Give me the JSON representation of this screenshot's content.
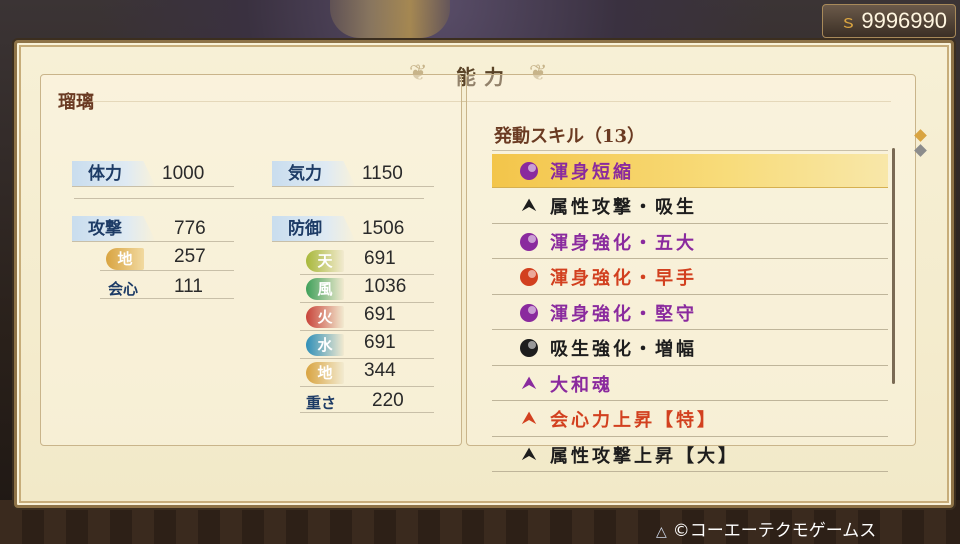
{
  "money": {
    "icon": "coin-icon",
    "value": "9996990"
  },
  "panel": {
    "title": "能力"
  },
  "character": {
    "name": "瑠璃"
  },
  "left_stats": {
    "stamina": {
      "label": "体力",
      "value": "1000"
    },
    "spirit": {
      "label": "気力",
      "value": "1150"
    },
    "attack": {
      "label": "攻撃",
      "value": "776"
    },
    "attack_element": {
      "label": "地",
      "value": "257",
      "color": "#d9a441"
    },
    "critical": {
      "label": "会心",
      "value": "111"
    },
    "defense": {
      "label": "防御",
      "value": "1506"
    },
    "defense_elements": [
      {
        "label": "天",
        "value": "691",
        "color": "#a8b83a"
      },
      {
        "label": "風",
        "value": "1036",
        "color": "#3fa05a"
      },
      {
        "label": "火",
        "value": "691",
        "color": "#c8443a"
      },
      {
        "label": "水",
        "value": "691",
        "color": "#2f8fb8"
      },
      {
        "label": "地",
        "value": "344",
        "color": "#d9a441"
      }
    ],
    "weight": {
      "label": "重さ",
      "value": "220"
    }
  },
  "skills": {
    "header": "発動スキル",
    "count": "（13）",
    "items": [
      {
        "name": "渾身短縮",
        "icon": "purple-orb-icon",
        "color": "#8a2a9e",
        "selected": true
      },
      {
        "name": "属性攻撃・吸生",
        "icon": "black-chevron-icon",
        "color": "#1d1d1d",
        "selected": false
      },
      {
        "name": "渾身強化・五大",
        "icon": "purple-orb-icon",
        "color": "#8a2a9e",
        "selected": false
      },
      {
        "name": "渾身強化・早手",
        "icon": "red-orb-icon",
        "color": "#d2401f",
        "selected": false
      },
      {
        "name": "渾身強化・堅守",
        "icon": "purple-orb-icon",
        "color": "#8a2a9e",
        "selected": false
      },
      {
        "name": "吸生強化・増幅",
        "icon": "black-orb-icon",
        "color": "#1d1d1d",
        "selected": false
      },
      {
        "name": "大和魂",
        "icon": "purple-chevron-icon",
        "color": "#8a2a9e",
        "selected": false
      },
      {
        "name": "会心力上昇【特】",
        "icon": "red-chevron-icon",
        "color": "#d2401f",
        "selected": false
      },
      {
        "name": "属性攻撃上昇【大】",
        "icon": "black-chevron-icon",
        "color": "#1d1d1d",
        "selected": false
      }
    ]
  },
  "footer": {
    "copyright": "©コーエーテクモゲームス"
  }
}
